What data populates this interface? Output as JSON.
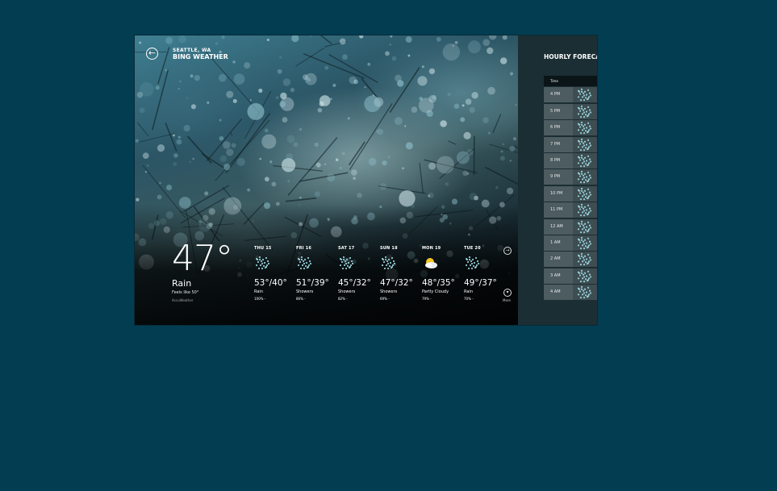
{
  "header": {
    "city": "SEATTLE, WA",
    "app_title": "BING WEATHER"
  },
  "current": {
    "temp": "47°",
    "condition": "Rain",
    "feels_like": "Feels like 50°",
    "source": "AccuWeather"
  },
  "daily": [
    {
      "day": "THU 15",
      "hilo": "53°/40°",
      "condition": "Rain",
      "precip": "100%",
      "icon": "rain-icon"
    },
    {
      "day": "FRI 16",
      "hilo": "51°/39°",
      "condition": "Showers",
      "precip": "86%",
      "icon": "rain-icon"
    },
    {
      "day": "SAT 17",
      "hilo": "45°/32°",
      "condition": "Showers",
      "precip": "82%",
      "icon": "rain-icon"
    },
    {
      "day": "SUN 18",
      "hilo": "47°/32°",
      "condition": "Showers",
      "precip": "69%",
      "icon": "rain-icon"
    },
    {
      "day": "MON 19",
      "hilo": "48°/35°",
      "condition": "Partly Cloudy",
      "precip": "79%",
      "icon": "partly-cloudy-icon"
    },
    {
      "day": "TUE 20",
      "hilo": "49°/37°",
      "condition": "Rain",
      "precip": "70%",
      "icon": "rain-icon"
    }
  ],
  "more_label": "More",
  "hourly": {
    "title": "HOURLY FORECAS",
    "column_header": "Time",
    "rows": [
      "4 PM",
      "5 PM",
      "6 PM",
      "7 PM",
      "8 PM",
      "9 PM",
      "10 PM",
      "11 PM",
      "12 AM",
      "1 AM",
      "2 AM",
      "3 AM",
      "4 AM"
    ]
  },
  "colors": {
    "desktop_bg": "#023d52",
    "hourly_row": "#4c5c60",
    "hourly_header": "#0b1518"
  }
}
